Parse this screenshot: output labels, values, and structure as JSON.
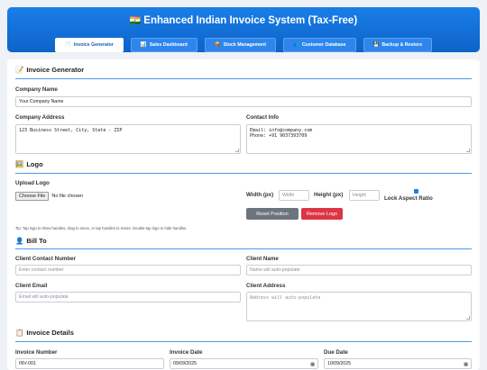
{
  "header": {
    "flag": "🇮🇳",
    "title": "Enhanced Indian Invoice System (Tax-Free)"
  },
  "nav": [
    {
      "icon": "📄",
      "label": "Invoice Generator"
    },
    {
      "icon": "📊",
      "label": "Sales Dashboard"
    },
    {
      "icon": "📦",
      "label": "Stock Management"
    },
    {
      "icon": "👥",
      "label": "Customer Database"
    },
    {
      "icon": "💾",
      "label": "Backup & Restore"
    }
  ],
  "invoice_generator": {
    "icon": "📝",
    "title": "Invoice Generator",
    "company_name_label": "Company Name",
    "company_name_value": "Your Company Name",
    "company_address_label": "Company Address",
    "company_address_value": "123 Business Street, City, State - ZIP",
    "contact_info_label": "Contact Info",
    "contact_info_value": "Email: info@company.com\nPhone: +91 9037393709"
  },
  "logo": {
    "icon": "🖼️",
    "title": "Logo",
    "upload_label": "Upload Logo",
    "choose_file": "Choose File",
    "no_file": "No file chosen",
    "width_label": "Width (px)",
    "width_placeholder": "Width",
    "height_label": "Height (px)",
    "height_placeholder": "Height",
    "lock_label": "Lock Aspect Ratio",
    "lock_checked": true,
    "reset_button": "Reset Position",
    "remove_button": "Remove Logo",
    "tip": "Tip: Tap logo to show handles, drag to move, or tap handles to resize. Double-tap logo to hide handles."
  },
  "bill_to": {
    "icon": "👤",
    "title": "Bill To",
    "client_contact_label": "Client Contact Number",
    "client_contact_placeholder": "Enter contact number",
    "client_name_label": "Client Name",
    "client_name_placeholder": "Name will auto-populate",
    "client_email_label": "Client Email",
    "client_email_placeholder": "Email will auto-populate",
    "client_address_label": "Client Address",
    "client_address_placeholder": "Address will auto-populate"
  },
  "invoice_details": {
    "icon": "📋",
    "title": "Invoice Details",
    "invoice_number_label": "Invoice Number",
    "invoice_number_value": "INV-001",
    "invoice_date_label": "Invoice Date",
    "invoice_date_value": "09/09/2025",
    "due_date_label": "Due Date",
    "due_date_value": "10/09/2025"
  },
  "colors": {
    "header_bg": "#1a7ee8",
    "accent_line": "#4a9be8",
    "reset_button": "#6c757d",
    "remove_button": "#dc3545"
  }
}
